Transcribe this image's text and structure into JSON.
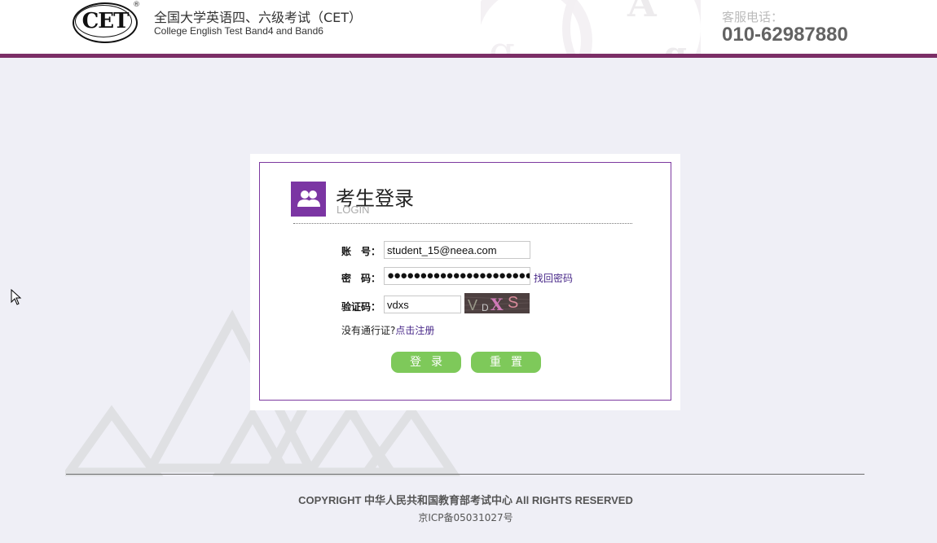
{
  "header": {
    "logo_text": "CET",
    "logo_reg_mark": "®",
    "title_cn": "全国大学英语四、六级考试（CET）",
    "title_en": "College English Test Band4 and Band6",
    "hotline_label": "客服电话：",
    "hotline_number": "010-62987880",
    "accent_color": "#7b2e66"
  },
  "login": {
    "title": "考生登录",
    "subtitle": "LOGIN",
    "icon": "users-icon",
    "fields": {
      "account_label": "账　号：",
      "account_value": "student_15@neea.com",
      "password_label": "密　码：",
      "password_value": "●●●●●●●●●●●●●●●●●●●●●●",
      "forgot_link": "找回密码",
      "captcha_label": "验证码：",
      "captcha_value": "vdxs",
      "captcha_image_text": [
        "V",
        "D",
        "X",
        "S"
      ]
    },
    "register_prompt": "没有通行证?",
    "register_link": "点击注册",
    "buttons": {
      "login": "登录",
      "reset": "重置"
    },
    "button_color": "#7ec95a",
    "border_color": "#7d3aa0"
  },
  "footer": {
    "copyright": "COPYRIGHT 中华人民共和国教育部考试中心 All RIGHTS RESERVED",
    "icp": "京ICP备05031027号"
  }
}
